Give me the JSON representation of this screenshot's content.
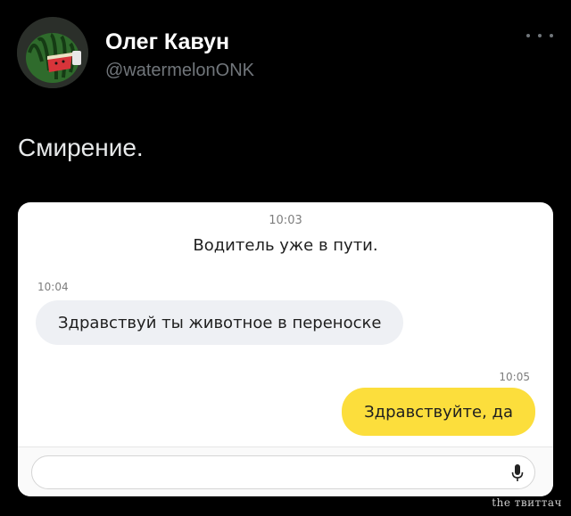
{
  "author": {
    "name": "Олег Кавун",
    "handle": "@watermelonONK",
    "avatar_icon": "watermelon-avatar"
  },
  "tweet": {
    "text": "Смирение."
  },
  "chat": {
    "system_time": "10:03",
    "system_message": "Водитель уже в пути.",
    "incoming_time": "10:04",
    "incoming_text": "Здравствуй ты животное в переноске",
    "outgoing_time": "10:05",
    "outgoing_text": "Здравствуйте, да",
    "mic_icon": "microphone-icon",
    "colors": {
      "incoming_bubble": "#eef0f4",
      "outgoing_bubble": "#fcde3c"
    }
  },
  "watermark": "the твиттач",
  "icons": {
    "more": "more-options-icon"
  }
}
